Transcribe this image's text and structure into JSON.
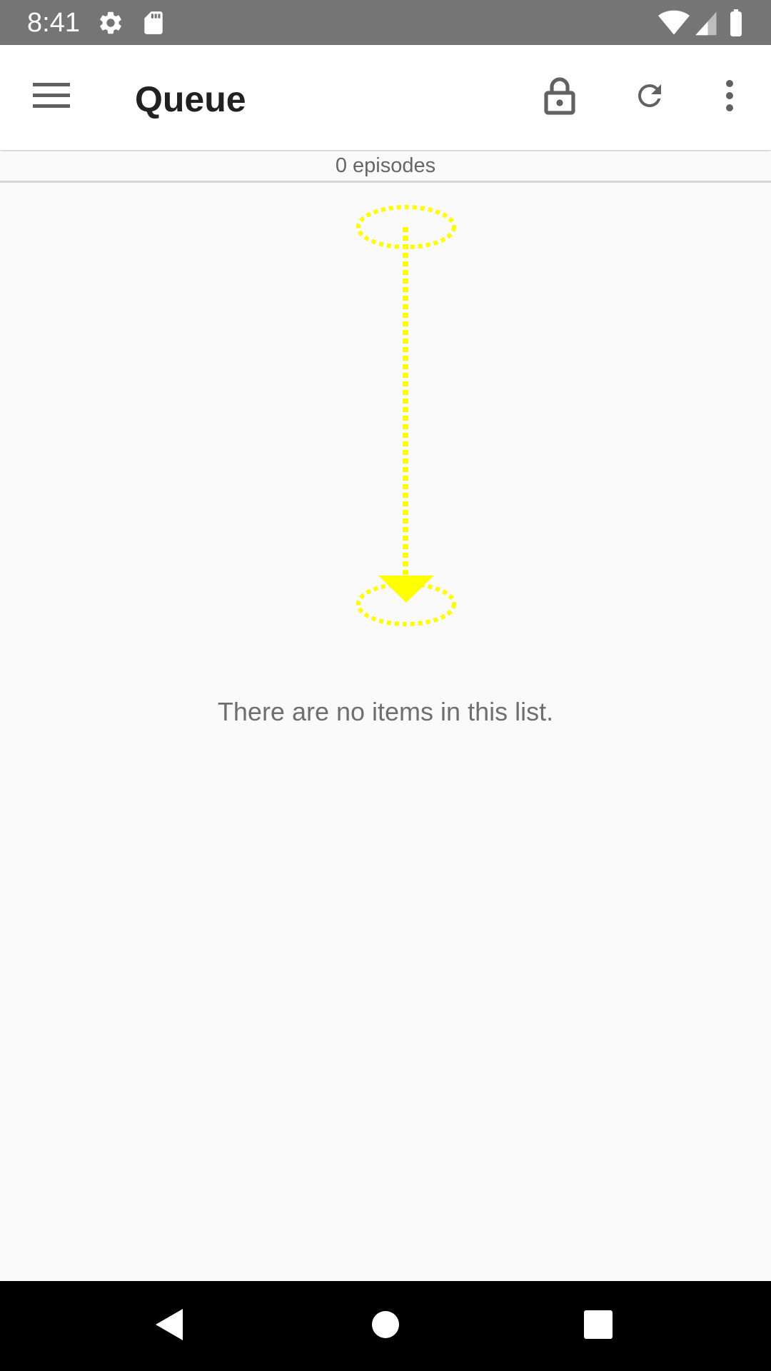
{
  "status_bar": {
    "time": "8:41",
    "icons": [
      "gear-icon",
      "sd-card-icon",
      "wifi-icon",
      "cell-signal-icon",
      "battery-icon"
    ]
  },
  "app_bar": {
    "title": "Queue",
    "actions": [
      "menu-icon",
      "lock-icon",
      "refresh-icon",
      "more-vert-icon"
    ]
  },
  "list": {
    "episode_count": "0 episodes",
    "empty_message": "There are no items in this list."
  },
  "gesture_hint": {
    "type": "swipe-down",
    "color": "#ffff00"
  },
  "nav_bar": {
    "buttons": [
      "back-icon",
      "home-icon",
      "recents-icon"
    ]
  },
  "colors": {
    "status_bar": "#757575",
    "app_bar": "#ffffff",
    "background": "#fafafa",
    "nav_bar": "#000000",
    "title_text": "#212121",
    "secondary_text": "#666666"
  }
}
